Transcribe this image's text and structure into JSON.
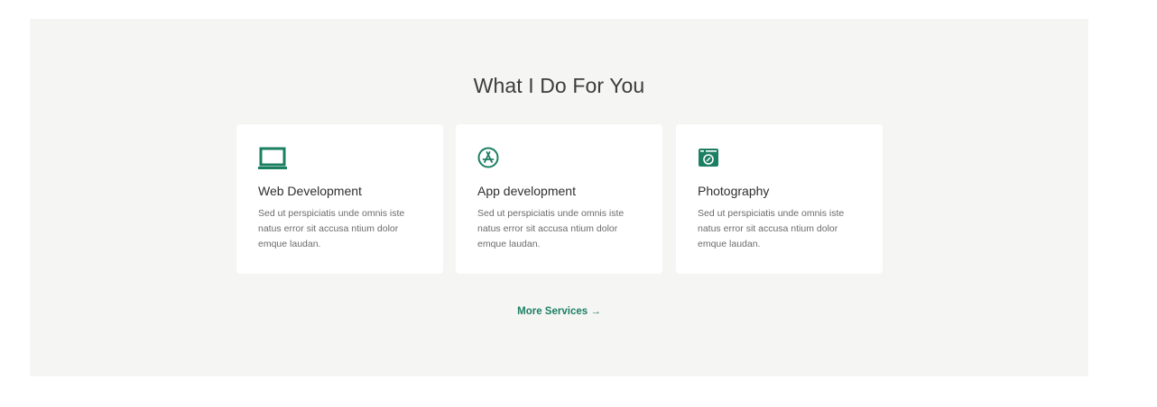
{
  "section": {
    "title": "What I Do For You",
    "accent_color": "#1d7f62",
    "background_color": "#f5f5f4"
  },
  "cards": [
    {
      "icon": "laptop-icon",
      "title": "Web Development",
      "description": "Sed ut perspiciatis unde omnis iste natus error sit accusa ntium dolor emque laudan."
    },
    {
      "icon": "app-store-icon",
      "title": "App development",
      "description": "Sed ut perspiciatis unde omnis iste natus error sit accusa ntium dolor emque laudan."
    },
    {
      "icon": "camera-icon",
      "title": "Photography",
      "description": "Sed ut perspiciatis unde omnis iste natus error sit accusa ntium dolor emque laudan."
    }
  ],
  "more_link": {
    "label": "More Services",
    "arrow": "→"
  }
}
